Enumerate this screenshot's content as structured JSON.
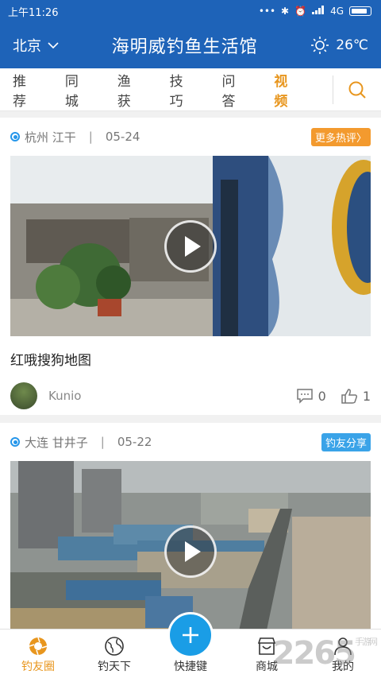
{
  "status": {
    "time": "上午11:26",
    "network": "4G"
  },
  "header": {
    "city": "北京",
    "title": "海明威钓鱼生活馆",
    "temperature": "26℃"
  },
  "tabs": [
    {
      "label": "推荐"
    },
    {
      "label": "同城"
    },
    {
      "label": "渔获"
    },
    {
      "label": "技巧"
    },
    {
      "label": "问答"
    },
    {
      "label": "视频",
      "active": true
    }
  ],
  "posts": [
    {
      "location": "杭州 江干",
      "separator": "|",
      "date": "05-24",
      "badge": "更多热评〉",
      "badge_color": "#f39a2e",
      "title": "红哦搜狗地图",
      "author": "Kunio",
      "comments": "0",
      "likes": "1"
    },
    {
      "location": "大连 甘井子",
      "separator": "|",
      "date": "05-22",
      "badge": "钓友分享",
      "badge_color": "#3aa3e8"
    }
  ],
  "nav": {
    "items": [
      {
        "label": "钓友圈",
        "icon": "aperture-icon",
        "active": true
      },
      {
        "label": "钓天下",
        "icon": "globe-icon"
      },
      {
        "label": "快捷键",
        "icon": "plus-icon"
      },
      {
        "label": "商城",
        "icon": "store-icon"
      },
      {
        "label": "我的",
        "icon": "user-icon"
      }
    ]
  },
  "watermark": {
    "main": "2265",
    "sub": "手游网"
  },
  "colors": {
    "header": "#1e63b8",
    "accent": "#e8961e",
    "fab": "#1a9de6"
  }
}
